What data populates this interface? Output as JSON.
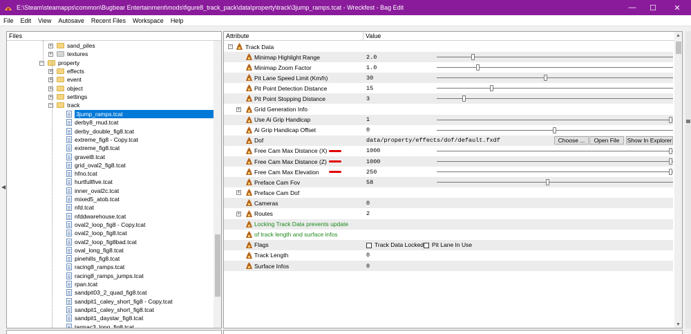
{
  "window": {
    "title": "E:\\Steam\\steamapps\\common\\Bugbear Entertainment\\mods\\figure8_track_pack\\data\\property\\track\\3jump_ramps.tcat - Wreckfest - Bag Edit",
    "minimize": "—",
    "maximize": "☐",
    "close": "✕",
    "accent": "#8a1b9b"
  },
  "menu": [
    "File",
    "Edit",
    "View",
    "Autosave",
    "Recent Files",
    "Workspace",
    "Help"
  ],
  "files_panel": {
    "header": "Files",
    "folders": [
      {
        "label": "sand_piles",
        "expander": "+"
      },
      {
        "label": "textures",
        "expander": "+"
      },
      {
        "label": "property",
        "expander": "−"
      },
      {
        "label": "effects",
        "expander": "+"
      },
      {
        "label": "event",
        "expander": "+"
      },
      {
        "label": "object",
        "expander": "+"
      },
      {
        "label": "settings",
        "expander": "+"
      },
      {
        "label": "track",
        "expander": "−"
      }
    ],
    "files": [
      "3jump_ramps.tcat",
      "derby8_mud.tcat",
      "derby_double_fig8.tcat",
      "extreme_fig8 - Copy.tcat",
      "extreme_fig8.tcat",
      "gravel8.tcat",
      "grid_oval2_fig8.tcat",
      "hfno.tcat",
      "hurtfullfive.tcat",
      "inner_oval2c.tcat",
      "mixed5_atob.tcat",
      "nfd.tcat",
      "nfddwarehouse.tcat",
      "oval2_loop_fig8 - Copy.tcat",
      "oval2_loop_fig8.tcat",
      "oval2_loop_fig8bad.tcat",
      "oval_long_fig8.tcat",
      "pinehills_fig8.tcat",
      "racing8_ramps.tcat",
      "racing8_ramps_jumps.tcat",
      "rpan.tcat",
      "sandpit03_2_quad_fig8.tcat",
      "sandpit1_caley_short_fig8 - Copy.tcat",
      "sandpit1_caley_short_fig8.tcat",
      "sandpit1_daystar_fig8.tcat",
      "tarmac3_long_fig8.tcat"
    ]
  },
  "props_panel": {
    "col_attribute": "Attribute",
    "col_value": "Value",
    "root": {
      "label": "Track Data",
      "expander": "−"
    },
    "rows": [
      {
        "label": "Minimap Highlight Range",
        "value": "2.0",
        "slider": 0.15
      },
      {
        "label": "Minimap Zoom Factor",
        "value": "1.0",
        "slider": 0.17
      },
      {
        "label": "Pit Lane Speed Limit (Km/h)",
        "value": "30",
        "slider": 0.46
      },
      {
        "label": "Pit Point Detection Distance",
        "value": "15",
        "slider": 0.23
      },
      {
        "label": "Pit Point Stopping Distance",
        "value": "3",
        "slider": 0.11
      },
      {
        "label": "Grid Generation Info",
        "value": "",
        "expander": "+"
      },
      {
        "label": "Use Ai Grip Handicap",
        "value": "1",
        "slider": 1.0
      },
      {
        "label": "Ai Grip Handicap Offset",
        "value": "0",
        "slider": 0.5
      },
      {
        "label": "Dof",
        "value": "data/property/effects/dof/default.fxdf",
        "buttons": [
          "Choose ...",
          "Open File",
          "Show In Explorer"
        ]
      },
      {
        "label": "Free Cam Max Distance (X)",
        "value": "1000",
        "slider": 1.0,
        "mark": true
      },
      {
        "label": "Free Cam Max Distance (Z)",
        "value": "1000",
        "slider": 1.0,
        "mark": true
      },
      {
        "label": "Free Cam Max Elevation",
        "value": "250",
        "slider": 1.0,
        "mark": true
      },
      {
        "label": "Preface Cam Fov",
        "value": "58",
        "slider": 0.47
      },
      {
        "label": "Preface Cam Dof",
        "value": "",
        "expander": "+"
      },
      {
        "label": "Cameras",
        "value": "0"
      },
      {
        "label": "Routes",
        "value": "2",
        "expander": "+"
      },
      {
        "label": "Locking Track Data prevents update",
        "value": "",
        "green": true
      },
      {
        "label": "of track length and surface infos",
        "value": "",
        "green": true
      },
      {
        "label": "Flags",
        "value": "",
        "checks": [
          "Track Data Locked",
          "Pit Lane In Use"
        ]
      },
      {
        "label": "Track Length",
        "value": "0"
      },
      {
        "label": "Surface Infos",
        "value": "0"
      }
    ]
  }
}
